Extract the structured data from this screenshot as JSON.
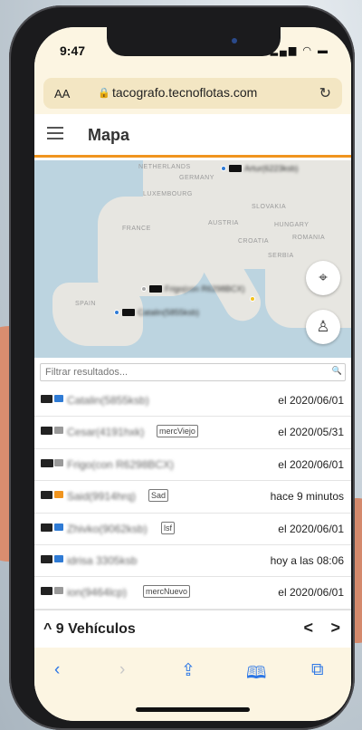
{
  "status": {
    "time": "9:47",
    "icons": "▂▄▆ ◠ ▬"
  },
  "browser": {
    "text_size_label": "AA",
    "lock": "🔒",
    "url": "tacografo.tecnoflotas.com",
    "reload": "↻"
  },
  "app": {
    "title": "Mapa"
  },
  "map": {
    "labels": [
      "NETHERLANDS",
      "GERMANY",
      "LUXEMBOURG",
      "SLOVAKIA",
      "FRANCE",
      "AUSTRIA",
      "HUNGARY",
      "CROATIA",
      "ROMANIA",
      "SERBIA",
      "SPAIN"
    ],
    "markers": [
      "Artur(6223ksb)",
      "Frigo(con R6298BCX)",
      "Catalin(5855ksb)"
    ],
    "locate_button_icon": "⌖",
    "driver_button_icon": "♙"
  },
  "filter": {
    "placeholder": "Filtrar resultados...",
    "search_icon": "🔍"
  },
  "vehicles": [
    {
      "name": "Catalin(5855ksb)",
      "tag": "",
      "date": "el 2020/06/01",
      "card_color": "#2f7bd5"
    },
    {
      "name": "Cesar(4191hxk)",
      "tag": "mercViejo",
      "date": "el 2020/05/31",
      "card_color": "#9a9a9a"
    },
    {
      "name": "Frigo(con R6298BCX)",
      "tag": "",
      "date": "el 2020/06/01",
      "card_color": "#9a9a9a"
    },
    {
      "name": "Said(9914hrq)",
      "tag": "Sad",
      "date": "hace 9 minutos",
      "card_color": "#f0941e"
    },
    {
      "name": "Zhivko(9062ksb)",
      "tag": "lsf",
      "date": "el 2020/06/01",
      "card_color": "#2f7bd5"
    },
    {
      "name": "idrisa 3305ksb",
      "tag": "",
      "date": "hoy a las 08:06",
      "card_color": "#2f7bd5"
    },
    {
      "name": "ion(9464lcp)",
      "tag": "mercNuevo",
      "date": "el 2020/06/01",
      "card_color": "#9a9a9a"
    }
  ],
  "footer": {
    "count_label": "^ 9 Vehículos",
    "prev": "<",
    "next": ">"
  },
  "toolbar": {
    "back": "‹",
    "forward": "›",
    "share": "⇪",
    "bookmarks": "🕮",
    "tabs": "⧉"
  }
}
